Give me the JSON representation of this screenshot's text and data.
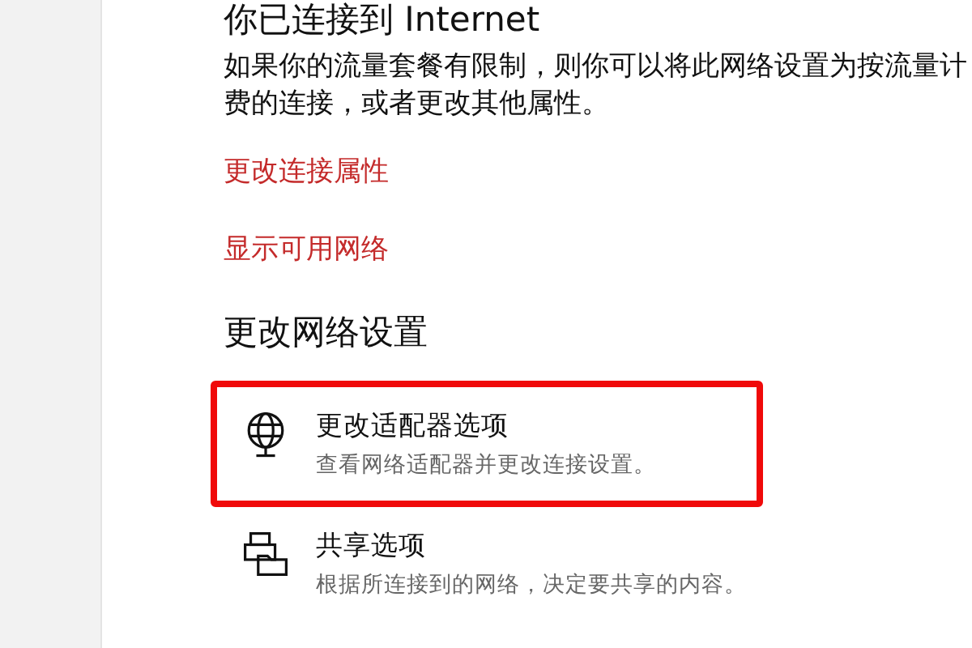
{
  "status": {
    "title": "你已连接到 Internet",
    "description": "如果你的流量套餐有限制，则你可以将此网络设置为按流量计费的连接，或者更改其他属性。"
  },
  "links": [
    "更改连接属性",
    "显示可用网络"
  ],
  "section": {
    "title": "更改网络设置",
    "items": [
      {
        "kind": "adapter",
        "title": "更改适配器选项",
        "subtitle": "查看网络适配器并更改连接设置。",
        "highlighted": true
      },
      {
        "kind": "sharing",
        "title": "共享选项",
        "subtitle": "根据所连接到的网络，决定要共享的内容。",
        "highlighted": false
      }
    ]
  }
}
